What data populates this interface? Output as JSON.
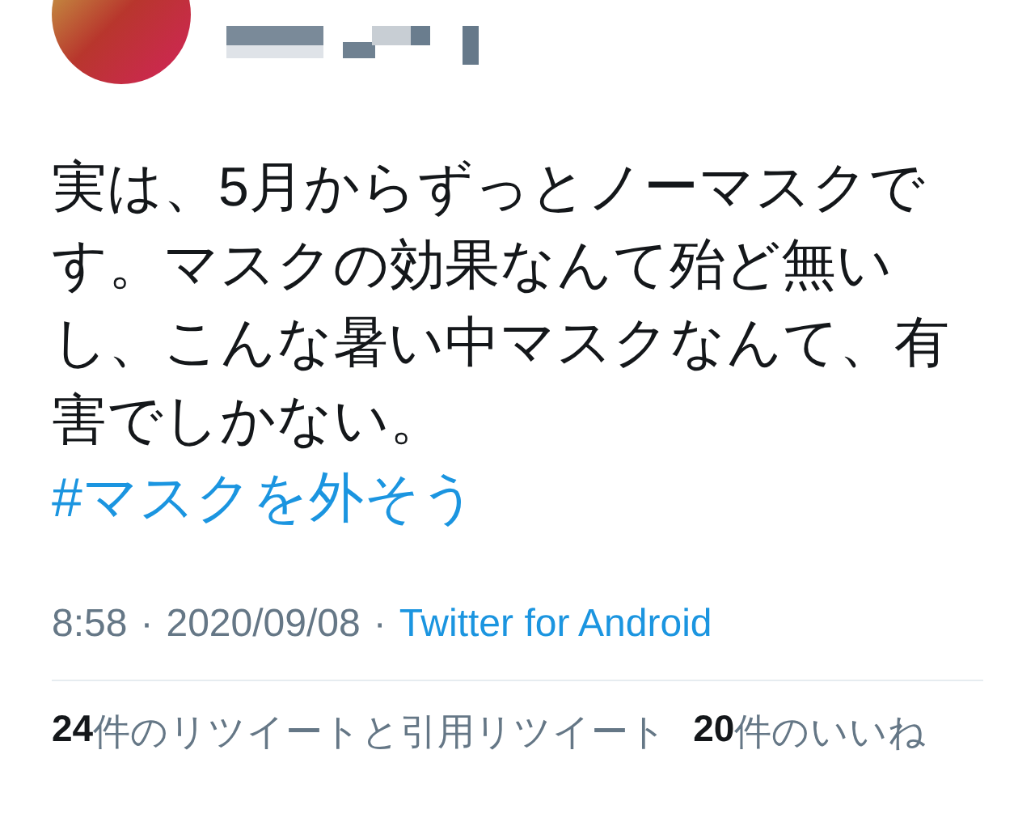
{
  "tweet": {
    "text": "実は、5月からずっとノーマスクです。マスクの効果なんて殆ど無いし、こんな暑い中マスクなんて、有害でしかない。",
    "hashtag": "#マスクを外そう",
    "time": "8:58",
    "separator_1": "·",
    "date": "2020/09/08",
    "separator_2": "·",
    "source": "Twitter for Android",
    "stats": [
      {
        "count": "24",
        "label": "件のリツイートと引用リツイート"
      },
      {
        "count": "20",
        "label": "件のいいね"
      }
    ]
  }
}
